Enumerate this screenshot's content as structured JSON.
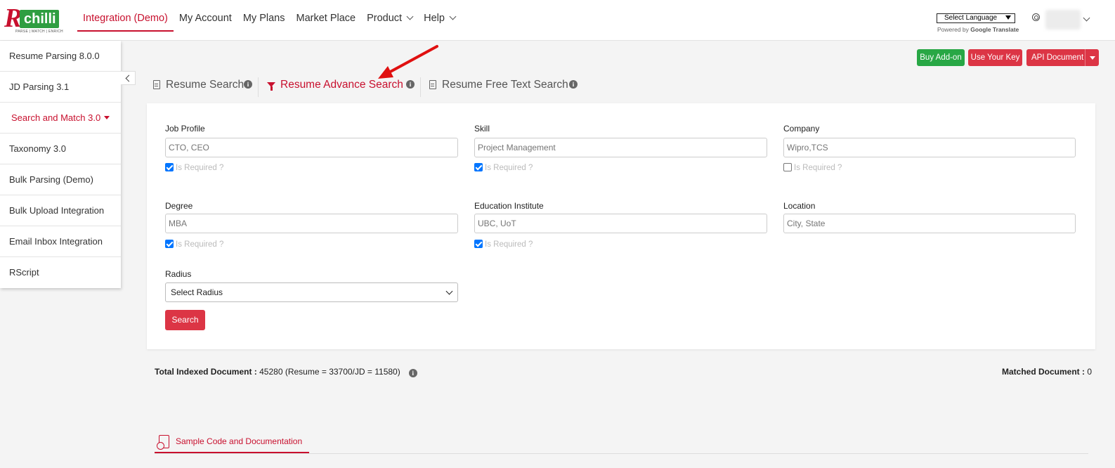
{
  "brand": {
    "logo_letter": "R",
    "logo_word": "chilli",
    "tagline": "PARSE | MATCH | ENRICH"
  },
  "nav": {
    "items": [
      {
        "label": "Integration (Demo)",
        "active": true
      },
      {
        "label": "My Account"
      },
      {
        "label": "My Plans"
      },
      {
        "label": "Market Place"
      },
      {
        "label": "Product",
        "dropdown": true
      },
      {
        "label": "Help",
        "dropdown": true
      }
    ]
  },
  "translate": {
    "select_label": "Select Language",
    "powered_prefix": "Powered by",
    "google": "Google",
    "translate_word": "Translate"
  },
  "sidebar": {
    "items": [
      {
        "label": "Resume Parsing 8.0.0"
      },
      {
        "label": "JD Parsing 3.1"
      },
      {
        "label": "Search and Match 3.0",
        "active": true
      },
      {
        "label": "Taxonomy 3.0"
      },
      {
        "label": "Bulk Parsing (Demo)"
      },
      {
        "label": "Bulk Upload Integration"
      },
      {
        "label": "Email Inbox Integration"
      },
      {
        "label": "RScript"
      }
    ]
  },
  "actions": {
    "buy_addon": "Buy Add-on",
    "use_key": "Use Your Key",
    "api_doc": "API Document"
  },
  "tabs": {
    "resume_search": "Resume Search",
    "advance_search": "Resume Advance Search",
    "free_text": "Resume Free Text Search",
    "info_glyph": "i"
  },
  "form": {
    "job_profile": {
      "label": "Job Profile",
      "placeholder": "CTO, CEO",
      "required": true
    },
    "skill": {
      "label": "Skill",
      "placeholder": "Project Management",
      "required": true
    },
    "company": {
      "label": "Company",
      "placeholder": "Wipro,TCS",
      "required": false
    },
    "degree": {
      "label": "Degree",
      "placeholder": "MBA",
      "required": true
    },
    "education": {
      "label": "Education Institute",
      "placeholder": "UBC, UoT",
      "required": true
    },
    "location": {
      "label": "Location",
      "placeholder": "City, State"
    },
    "radius": {
      "label": "Radius",
      "selected": "Select Radius"
    },
    "required_text": "Is Required ?",
    "search_button": "Search"
  },
  "stats": {
    "total_label": "Total Indexed Document :",
    "total_value": " 45280 (Resume = 33700/JD = 11580)",
    "matched_label": "Matched Document :",
    "matched_value": " 0"
  },
  "sample": {
    "label": "Sample Code and Documentation"
  },
  "colors": {
    "brand_red": "#c8102e",
    "button_red": "#dc3545",
    "button_green": "#28a745",
    "checkbox_blue": "#0075ff"
  }
}
